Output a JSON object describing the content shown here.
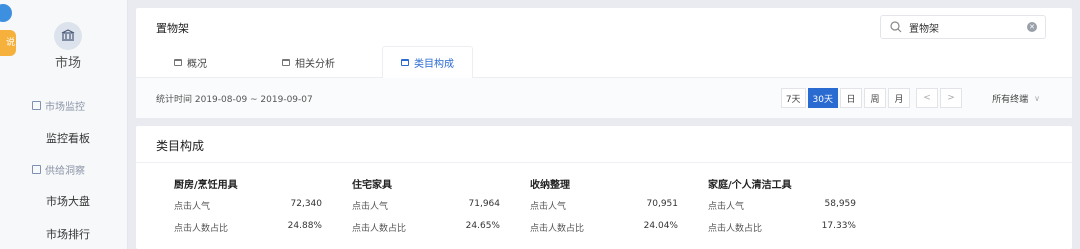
{
  "sidebar": {
    "badge_text": "说明",
    "market_label": "市场",
    "groups": [
      {
        "label": "市场监控",
        "items": [
          {
            "label": "监控看板"
          }
        ]
      },
      {
        "label": "供给洞察",
        "items": [
          {
            "label": "市场大盘"
          },
          {
            "label": "市场排行"
          }
        ]
      }
    ]
  },
  "header": {
    "title": "置物架",
    "search": {
      "value": "置物架",
      "placeholder": ""
    },
    "tabs": [
      {
        "label": "概况"
      },
      {
        "label": "相关分析"
      },
      {
        "label": "类目构成"
      }
    ],
    "active_tab": "类目构成"
  },
  "stats": {
    "range_text": "统计时间 2019-08-09 ~ 2019-09-07",
    "periods": [
      {
        "label": "7天"
      },
      {
        "label": "30天"
      },
      {
        "label": "日"
      },
      {
        "label": "周"
      },
      {
        "label": "月"
      }
    ],
    "active_period": "30天",
    "prev": "<",
    "next": ">",
    "terminal": "所有终端",
    "chevron": "∨"
  },
  "section": {
    "title": "类目构成",
    "categories": [
      {
        "name": "厨房/烹饪用具",
        "clicks_label": "点击人气",
        "clicks": "72,340",
        "share_label": "点击人数占比",
        "share": "24.88%"
      },
      {
        "name": "住宅家具",
        "clicks_label": "点击人气",
        "clicks": "71,964",
        "share_label": "点击人数占比",
        "share": "24.65%"
      },
      {
        "name": "收纳整理",
        "clicks_label": "点击人气",
        "clicks": "70,951",
        "share_label": "点击人数占比",
        "share": "24.04%"
      },
      {
        "name": "家庭/个人清洁工具",
        "clicks_label": "点击人气",
        "clicks": "58,959",
        "share_label": "点击人数占比",
        "share": "17.33%"
      }
    ]
  },
  "colors": {
    "accent": "#2a6bd1",
    "badge": "#f6b03c"
  },
  "icons": {
    "market": "market-building-icon",
    "search": "search-icon",
    "clear": "clear-icon"
  }
}
